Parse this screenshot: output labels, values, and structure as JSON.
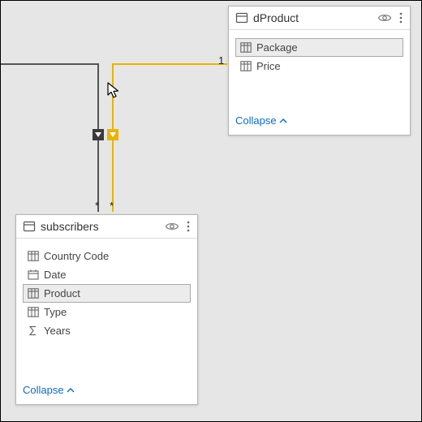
{
  "tables": {
    "dProduct": {
      "title": "dProduct",
      "fields": [
        {
          "label": "Package",
          "icon": "table",
          "selected": true
        },
        {
          "label": "Price",
          "icon": "table",
          "selected": false
        }
      ],
      "collapse": "Collapse"
    },
    "subscribers": {
      "title": "subscribers",
      "fields": [
        {
          "label": "Country Code",
          "icon": "table",
          "selected": false
        },
        {
          "label": "Date",
          "icon": "calendar",
          "selected": false
        },
        {
          "label": "Product",
          "icon": "table",
          "selected": true
        },
        {
          "label": "Type",
          "icon": "table",
          "selected": false
        },
        {
          "label": "Years",
          "icon": "sum",
          "selected": false
        }
      ],
      "collapse": "Collapse"
    }
  },
  "relationship": {
    "one_side": "1",
    "many_side_a": "*",
    "many_side_b": "*"
  }
}
